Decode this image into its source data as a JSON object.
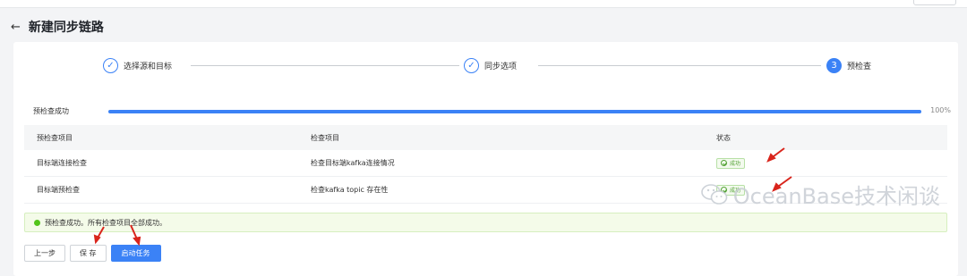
{
  "header": {
    "back_icon": "arrow-left-icon",
    "title": "新建同步链路"
  },
  "steps": [
    {
      "label": "选择源和目标",
      "state": "done",
      "icon": "check-icon"
    },
    {
      "label": "同步选项",
      "state": "done",
      "icon": "check-icon"
    },
    {
      "label": "预检查",
      "state": "active",
      "number": "3"
    }
  ],
  "progress": {
    "label": "预检查成功",
    "percent_text": "100%",
    "value": 1.0
  },
  "table": {
    "columns": [
      "预检查项目",
      "检查项目",
      "状态"
    ],
    "rows": [
      {
        "item": "目标端连接检查",
        "check": "检查目标端kafka连接情况",
        "status": "成功"
      },
      {
        "item": "目标端预检查",
        "check": "检查kafka topic 存在性",
        "status": "成功"
      }
    ]
  },
  "alert": {
    "text": "预检查成功。所有检查项目全部成功。",
    "icon": "success-dot-icon"
  },
  "buttons": {
    "prev": "上一步",
    "save": "保 存",
    "start": "启动任务"
  },
  "watermark": {
    "text": "OceanBase技术闲谈",
    "icon": "wechat-icon"
  },
  "colors": {
    "accent": "#3b82f6",
    "success": "#52c41a",
    "annotation": "#d9251c"
  }
}
